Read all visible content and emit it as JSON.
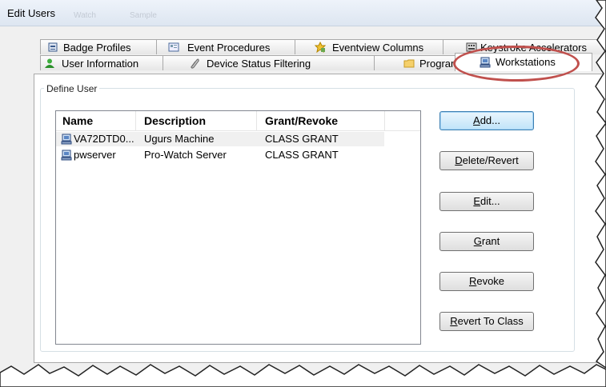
{
  "window": {
    "title": "Edit Users",
    "ghost_a": "Watch",
    "ghost_b": "Sample"
  },
  "tabs_back": [
    {
      "label": "Badge Profiles",
      "icon": "badge-profiles-icon"
    },
    {
      "label": "Event Procedures",
      "icon": "event-procedures-icon"
    },
    {
      "label": "Eventview Columns",
      "icon": "eventview-columns-icon"
    },
    {
      "label": "Keystroke Accelerators",
      "icon": "keystroke-accelerators-icon"
    }
  ],
  "tabs_front": [
    {
      "label": "User Information",
      "icon": "user-icon"
    },
    {
      "label": "Device Status Filtering",
      "icon": "paperclip-icon"
    },
    {
      "label": "Programs",
      "icon": "folder-icon"
    },
    {
      "label": "Workstations",
      "icon": "workstation-icon",
      "selected": true
    }
  ],
  "group": {
    "label": "Define User"
  },
  "list": {
    "columns": [
      "Name",
      "Description",
      "Grant/Revoke"
    ],
    "rows": [
      {
        "name": "VA72DTD0...",
        "description": "Ugurs Machine",
        "grant": "CLASS GRANT",
        "selected": true
      },
      {
        "name": "pwserver",
        "description": "Pro-Watch Server",
        "grant": "CLASS GRANT",
        "selected": false
      }
    ]
  },
  "buttons": {
    "add": {
      "mnemonic": "A",
      "rest": "dd..."
    },
    "delete": {
      "mnemonic": "D",
      "rest": "elete/Revert"
    },
    "edit": {
      "mnemonic": "E",
      "rest": "dit..."
    },
    "grant": {
      "mnemonic": "G",
      "rest": "rant"
    },
    "revoke": {
      "mnemonic": "R",
      "rest": "evoke"
    },
    "revert": {
      "mnemonic": "R",
      "rest": "evert To Class"
    }
  },
  "colors": {
    "annotation": "#c0504d",
    "accent": "#3c7fb1"
  }
}
